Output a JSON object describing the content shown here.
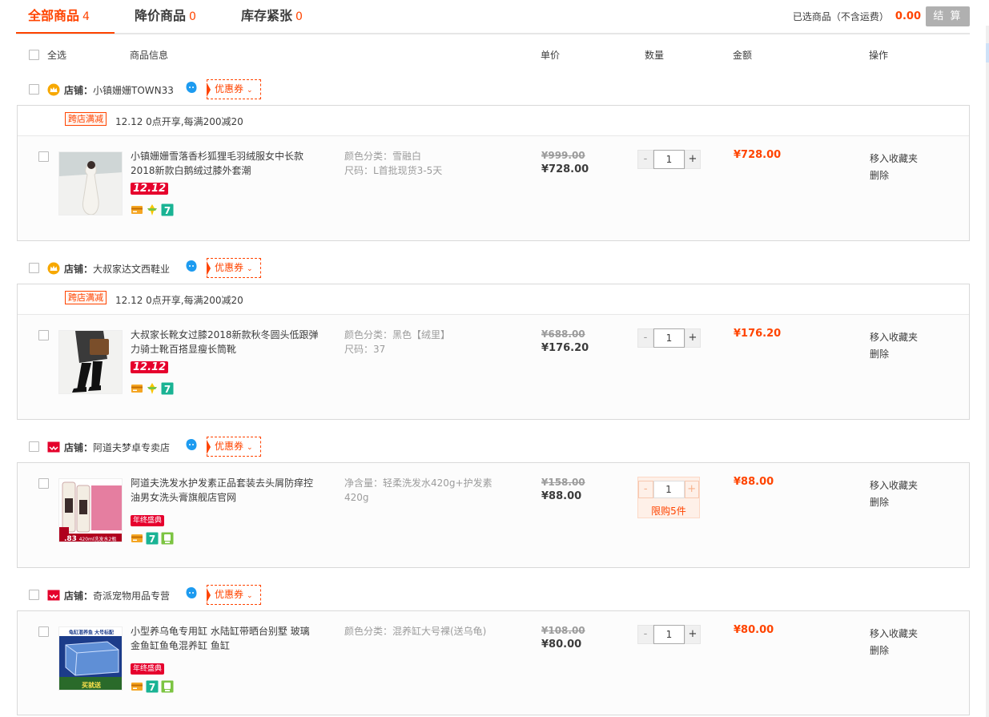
{
  "tabs": [
    {
      "label": "全部商品",
      "count": "4"
    },
    {
      "label": "降价商品",
      "count": "0"
    },
    {
      "label": "库存紧张",
      "count": "0"
    }
  ],
  "summary": {
    "selected_label": "已选商品（不含运费）",
    "amount": "0.00",
    "checkout_label": "结 算"
  },
  "columns": {
    "select_all": "全选",
    "info": "商品信息",
    "unit_price": "单价",
    "quantity": "数量",
    "amount": "金额",
    "action": "操作"
  },
  "shops": [
    {
      "label": "店铺：",
      "name": "小镇姗姗TOWN33",
      "coupon": "优惠券",
      "shop_icon": "crown-icon",
      "promo": {
        "tag": "跨店满减",
        "text": "12.12 0点开享,每满200减20"
      },
      "item": {
        "title": "小镇姗姗雪落香杉狐狸毛羽绒服女中长款2018新款白鹅绒过膝外套潮",
        "event_badge": "12.12",
        "sku_lines": [
          "颜色分类：雪融白",
          "尺码：L首批现货3-5天"
        ],
        "old_price": "¥999.00",
        "price": "¥728.00",
        "quantity": "1",
        "total": "¥728.00",
        "op_favorite": "移入收藏夹",
        "op_delete": "删除"
      }
    },
    {
      "label": "店铺：",
      "name": "大叔家达文西鞋业",
      "coupon": "优惠券",
      "shop_icon": "crown-icon",
      "promo": {
        "tag": "跨店满减",
        "text": "12.12 0点开享,每满200减20"
      },
      "item": {
        "title": "大叔家长靴女过膝2018新款秋冬圆头低跟弹力骑士靴百搭显瘦长筒靴",
        "event_badge": "12.12",
        "sku_lines": [
          "颜色分类：黑色【绒里】",
          "尺码：37"
        ],
        "old_price": "¥688.00",
        "price": "¥176.20",
        "quantity": "1",
        "total": "¥176.20",
        "op_favorite": "移入收藏夹",
        "op_delete": "删除"
      }
    },
    {
      "label": "店铺：",
      "name": "阿道夫梦卓专卖店",
      "coupon": "优惠券",
      "shop_icon": "tmall-icon",
      "item": {
        "title": "阿道夫洗发水护发素正品套装去头屑防痒控油男女洗头膏旗舰店官网",
        "event_badge": "年终盛典",
        "sku_lines": [
          "净含量：轻柔洗发水420g+护发素420g"
        ],
        "old_price": "¥158.00",
        "price": "¥88.00",
        "quantity": "1",
        "limit": "限购5件",
        "total": "¥88.00",
        "op_favorite": "移入收藏夹",
        "op_delete": "删除"
      }
    },
    {
      "label": "店铺：",
      "name": "奇派宠物用品专营",
      "coupon": "优惠券",
      "shop_icon": "tmall-icon",
      "item": {
        "title": "小型养乌龟专用缸 水陆缸带晒台别墅 玻璃金鱼缸鱼龟混养缸 鱼缸",
        "event_badge": "年终盛典",
        "sku_lines": [
          "颜色分类：混养缸大号裸(送乌龟)"
        ],
        "old_price": "¥108.00",
        "price": "¥80.00",
        "quantity": "1",
        "total": "¥80.00",
        "op_favorite": "移入收藏夹",
        "op_delete": "删除"
      }
    }
  ],
  "images": {
    "img1_caption": "",
    "img3_caption": "420ml洗发水2瓶",
    "img3_price": ".83",
    "img4_top": "龟缸混养鱼 大号标配",
    "img4_bottom": "买就送"
  },
  "colors": {
    "accent": "#ff4400",
    "border": "#d9d9d9",
    "checkout_bg": "#b0b0b0"
  }
}
